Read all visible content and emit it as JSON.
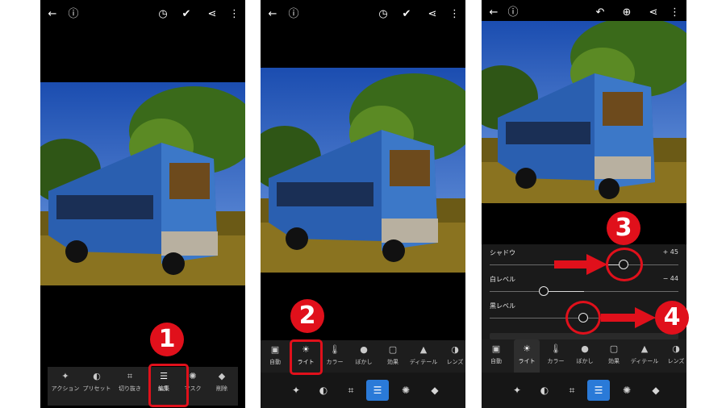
{
  "colors": {
    "accent": "#2a7ad8",
    "annotation_red": "#e0101b"
  },
  "header_icons": [
    "back-arrow-icon",
    "info-icon",
    "version-history-icon",
    "check-circle-icon",
    "share-icon",
    "more-vertical-icon"
  ],
  "panel3_header_icons": [
    "back-arrow-icon",
    "info-icon",
    "undo-icon",
    "add-circle-icon",
    "share-icon",
    "more-vertical-icon"
  ],
  "panel1": {
    "tools": [
      {
        "label": "アクション",
        "icon": "magic-wand-icon"
      },
      {
        "label": "プリセット",
        "icon": "presets-icon"
      },
      {
        "label": "切り抜き",
        "icon": "crop-icon"
      },
      {
        "label": "編集",
        "icon": "sliders-icon"
      },
      {
        "label": "マスク",
        "icon": "mask-icon"
      },
      {
        "label": "削除",
        "icon": "eraser-icon"
      }
    ],
    "active_tool": "編集"
  },
  "panel2": {
    "categories": [
      {
        "label": "自動",
        "icon": "auto-icon"
      },
      {
        "label": "ライト",
        "icon": "sun-icon"
      },
      {
        "label": "カラー",
        "icon": "thermometer-icon"
      },
      {
        "label": "ぼかし",
        "icon": "droplet-icon"
      },
      {
        "label": "効果",
        "icon": "effects-icon"
      },
      {
        "label": "ディテール",
        "icon": "detail-icon"
      },
      {
        "label": "レンズ",
        "icon": "lens-icon"
      }
    ],
    "selected": "ライト"
  },
  "panel3": {
    "sliders": [
      {
        "label": "シャドウ",
        "value": "+ 45",
        "level": 45
      },
      {
        "label": "白レベル",
        "value": "− 44",
        "level": -44
      },
      {
        "label": "黒レベル",
        "value": "",
        "level": 5
      }
    ]
  },
  "badges": [
    "1",
    "2",
    "3",
    "4"
  ]
}
